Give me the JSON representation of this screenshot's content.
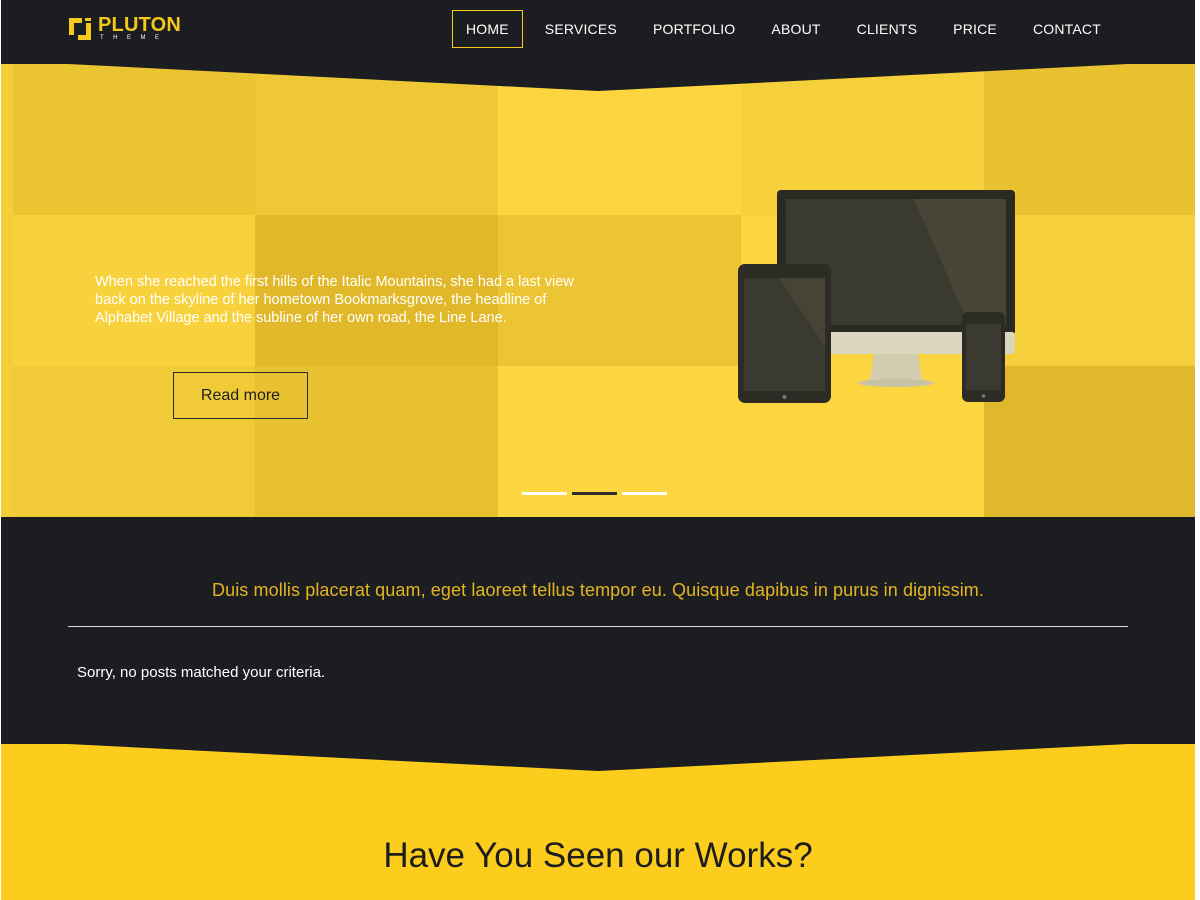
{
  "brand": {
    "name": "PLUTON",
    "subtitle": "THEME",
    "accent": "#f4c81c",
    "dark": "#1c1d20",
    "yellow": "#fccd1d"
  },
  "nav": {
    "items": [
      {
        "label": "HOME",
        "active": true
      },
      {
        "label": "SERVICES",
        "active": false
      },
      {
        "label": "PORTFOLIO",
        "active": false
      },
      {
        "label": "ABOUT",
        "active": false
      },
      {
        "label": "CLIENTS",
        "active": false
      },
      {
        "label": "PRICE",
        "active": false
      },
      {
        "label": "CONTACT",
        "active": false
      }
    ]
  },
  "hero": {
    "text": "When she reached the first hills of the Italic Mountains, she had a last view back on the skyline of her hometown Bookmarksgrove, the headline of Alphabet Village and the subline of her own road, the Line Lane.",
    "button_label": "Read more",
    "slides_total": 3,
    "active_slide": 2
  },
  "content": {
    "tagline": "Duis mollis placerat quam, eget laoreet tellus tempor eu. Quisque dapibus in purus in dignissim.",
    "empty_message": "Sorry, no posts matched your criteria."
  },
  "works": {
    "title": "Have You Seen our Works?"
  }
}
